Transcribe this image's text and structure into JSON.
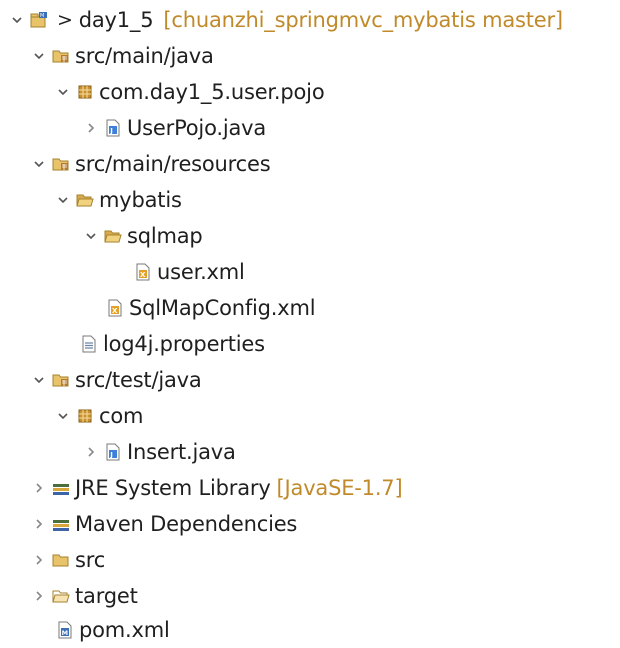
{
  "project_explorer": {
    "project": {
      "arrow": ">",
      "label": "day1_5",
      "decoration": "[chuanzhi_springmvc_mybatis master]"
    },
    "items": [
      {
        "label": "src/main/java"
      },
      {
        "label": "com.day1_5.user.pojo"
      },
      {
        "label": "UserPojo.java"
      },
      {
        "label": "src/main/resources"
      },
      {
        "label": "mybatis"
      },
      {
        "label": "sqlmap"
      },
      {
        "label": "user.xml"
      },
      {
        "label": "SqlMapConfig.xml"
      },
      {
        "label": "log4j.properties"
      },
      {
        "label": "src/test/java"
      },
      {
        "label": "com"
      },
      {
        "label": "Insert.java"
      },
      {
        "label": "JRE System Library",
        "decoration": "[JavaSE-1.7]"
      },
      {
        "label": "Maven Dependencies"
      },
      {
        "label": "src"
      },
      {
        "label": "target"
      },
      {
        "label": "pom.xml"
      }
    ]
  },
  "colors": {
    "decoration": "#c08a2b",
    "text": "#1f1f1f",
    "twisty": "#555555"
  }
}
